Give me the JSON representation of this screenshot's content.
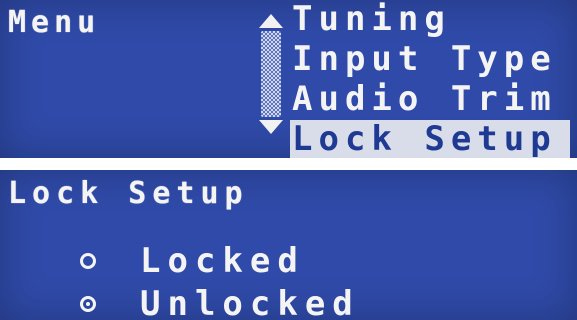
{
  "top_screen": {
    "title": "Menu",
    "menu_items": [
      {
        "label": "Tuning",
        "selected": false
      },
      {
        "label": "Input Type",
        "selected": false
      },
      {
        "label": "Audio Trim",
        "selected": false
      },
      {
        "label": "Lock Setup",
        "selected": true
      }
    ],
    "scroll_icons": [
      "scroll-up-arrow-icon",
      "scroll-track-icon",
      "scroll-down-arrow-icon"
    ]
  },
  "bottom_screen": {
    "title": "Lock Setup",
    "options": [
      {
        "label": "Locked",
        "selected": false
      },
      {
        "label": "Unlocked",
        "selected": true
      }
    ]
  },
  "colors": {
    "lcd_blue": "#2f4aa8",
    "text": "#f4f4f4",
    "highlight": "#d9dde9"
  }
}
